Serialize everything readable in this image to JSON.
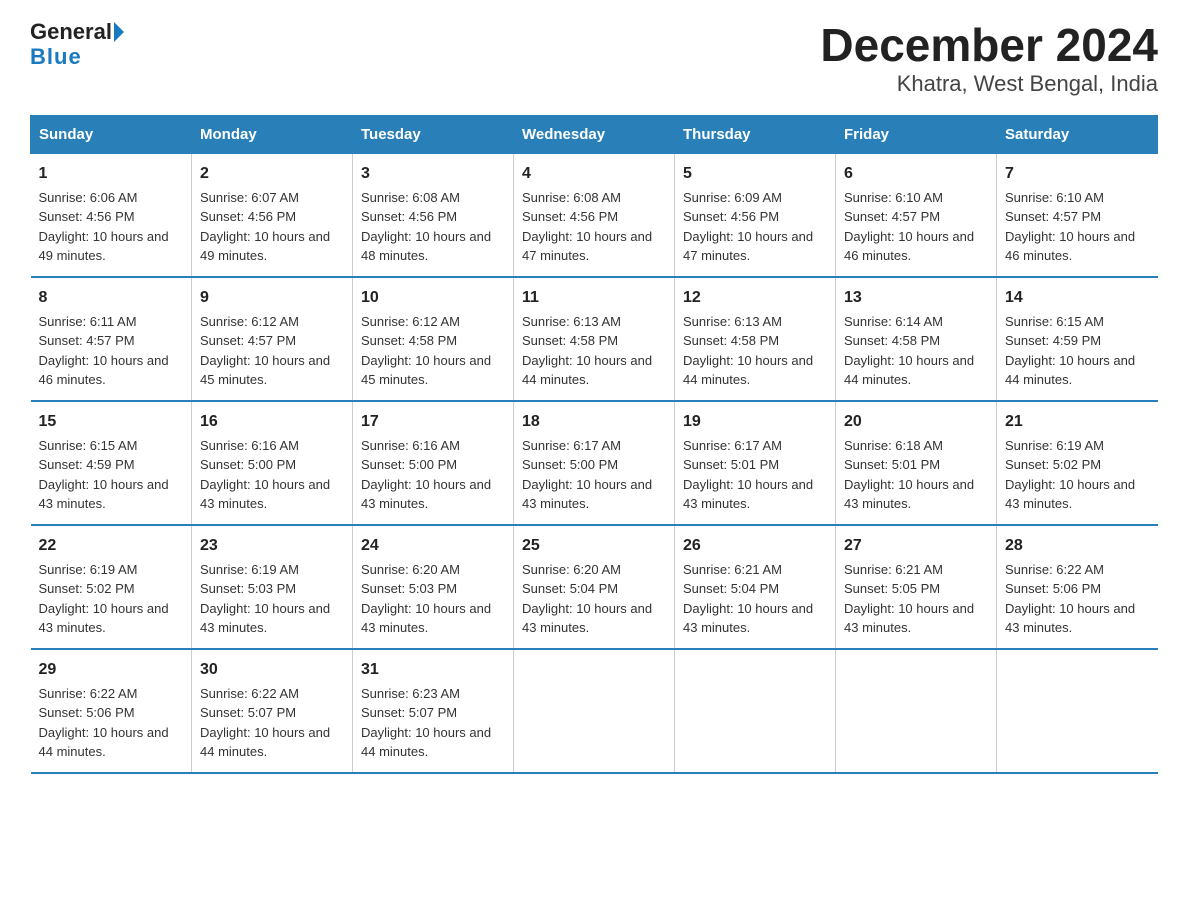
{
  "logo": {
    "general": "General",
    "blue": "Blue"
  },
  "title": "December 2024",
  "subtitle": "Khatra, West Bengal, India",
  "headers": [
    "Sunday",
    "Monday",
    "Tuesday",
    "Wednesday",
    "Thursday",
    "Friday",
    "Saturday"
  ],
  "weeks": [
    [
      {
        "day": "1",
        "sunrise": "6:06 AM",
        "sunset": "4:56 PM",
        "daylight": "10 hours and 49 minutes."
      },
      {
        "day": "2",
        "sunrise": "6:07 AM",
        "sunset": "4:56 PM",
        "daylight": "10 hours and 49 minutes."
      },
      {
        "day": "3",
        "sunrise": "6:08 AM",
        "sunset": "4:56 PM",
        "daylight": "10 hours and 48 minutes."
      },
      {
        "day": "4",
        "sunrise": "6:08 AM",
        "sunset": "4:56 PM",
        "daylight": "10 hours and 47 minutes."
      },
      {
        "day": "5",
        "sunrise": "6:09 AM",
        "sunset": "4:56 PM",
        "daylight": "10 hours and 47 minutes."
      },
      {
        "day": "6",
        "sunrise": "6:10 AM",
        "sunset": "4:57 PM",
        "daylight": "10 hours and 46 minutes."
      },
      {
        "day": "7",
        "sunrise": "6:10 AM",
        "sunset": "4:57 PM",
        "daylight": "10 hours and 46 minutes."
      }
    ],
    [
      {
        "day": "8",
        "sunrise": "6:11 AM",
        "sunset": "4:57 PM",
        "daylight": "10 hours and 46 minutes."
      },
      {
        "day": "9",
        "sunrise": "6:12 AM",
        "sunset": "4:57 PM",
        "daylight": "10 hours and 45 minutes."
      },
      {
        "day": "10",
        "sunrise": "6:12 AM",
        "sunset": "4:58 PM",
        "daylight": "10 hours and 45 minutes."
      },
      {
        "day": "11",
        "sunrise": "6:13 AM",
        "sunset": "4:58 PM",
        "daylight": "10 hours and 44 minutes."
      },
      {
        "day": "12",
        "sunrise": "6:13 AM",
        "sunset": "4:58 PM",
        "daylight": "10 hours and 44 minutes."
      },
      {
        "day": "13",
        "sunrise": "6:14 AM",
        "sunset": "4:58 PM",
        "daylight": "10 hours and 44 minutes."
      },
      {
        "day": "14",
        "sunrise": "6:15 AM",
        "sunset": "4:59 PM",
        "daylight": "10 hours and 44 minutes."
      }
    ],
    [
      {
        "day": "15",
        "sunrise": "6:15 AM",
        "sunset": "4:59 PM",
        "daylight": "10 hours and 43 minutes."
      },
      {
        "day": "16",
        "sunrise": "6:16 AM",
        "sunset": "5:00 PM",
        "daylight": "10 hours and 43 minutes."
      },
      {
        "day": "17",
        "sunrise": "6:16 AM",
        "sunset": "5:00 PM",
        "daylight": "10 hours and 43 minutes."
      },
      {
        "day": "18",
        "sunrise": "6:17 AM",
        "sunset": "5:00 PM",
        "daylight": "10 hours and 43 minutes."
      },
      {
        "day": "19",
        "sunrise": "6:17 AM",
        "sunset": "5:01 PM",
        "daylight": "10 hours and 43 minutes."
      },
      {
        "day": "20",
        "sunrise": "6:18 AM",
        "sunset": "5:01 PM",
        "daylight": "10 hours and 43 minutes."
      },
      {
        "day": "21",
        "sunrise": "6:19 AM",
        "sunset": "5:02 PM",
        "daylight": "10 hours and 43 minutes."
      }
    ],
    [
      {
        "day": "22",
        "sunrise": "6:19 AM",
        "sunset": "5:02 PM",
        "daylight": "10 hours and 43 minutes."
      },
      {
        "day": "23",
        "sunrise": "6:19 AM",
        "sunset": "5:03 PM",
        "daylight": "10 hours and 43 minutes."
      },
      {
        "day": "24",
        "sunrise": "6:20 AM",
        "sunset": "5:03 PM",
        "daylight": "10 hours and 43 minutes."
      },
      {
        "day": "25",
        "sunrise": "6:20 AM",
        "sunset": "5:04 PM",
        "daylight": "10 hours and 43 minutes."
      },
      {
        "day": "26",
        "sunrise": "6:21 AM",
        "sunset": "5:04 PM",
        "daylight": "10 hours and 43 minutes."
      },
      {
        "day": "27",
        "sunrise": "6:21 AM",
        "sunset": "5:05 PM",
        "daylight": "10 hours and 43 minutes."
      },
      {
        "day": "28",
        "sunrise": "6:22 AM",
        "sunset": "5:06 PM",
        "daylight": "10 hours and 43 minutes."
      }
    ],
    [
      {
        "day": "29",
        "sunrise": "6:22 AM",
        "sunset": "5:06 PM",
        "daylight": "10 hours and 44 minutes."
      },
      {
        "day": "30",
        "sunrise": "6:22 AM",
        "sunset": "5:07 PM",
        "daylight": "10 hours and 44 minutes."
      },
      {
        "day": "31",
        "sunrise": "6:23 AM",
        "sunset": "5:07 PM",
        "daylight": "10 hours and 44 minutes."
      },
      null,
      null,
      null,
      null
    ]
  ]
}
